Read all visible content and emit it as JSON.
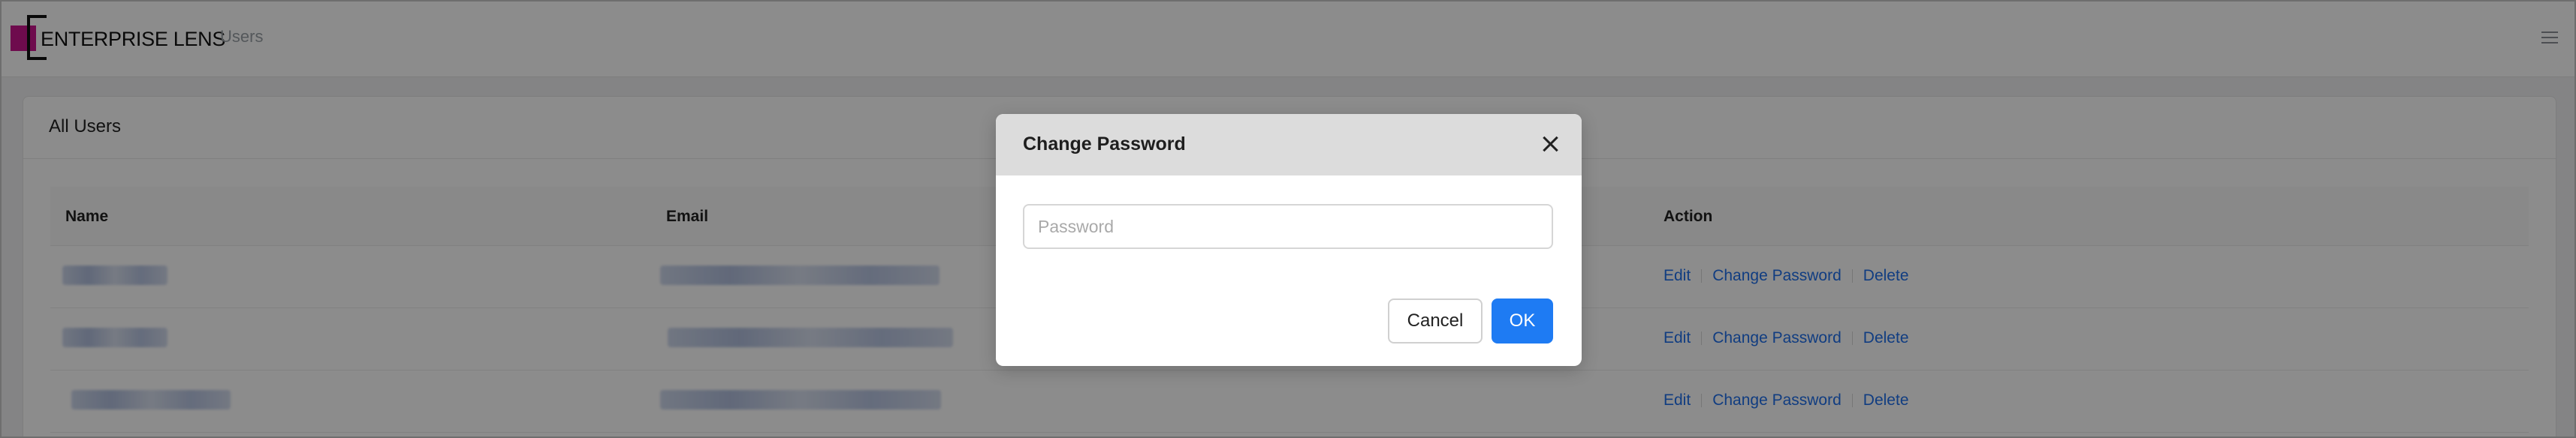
{
  "header": {
    "brand": "ENTERPRISE LENS",
    "page": "Users",
    "menu_icon": "hamburger-icon"
  },
  "card": {
    "title": "All Users"
  },
  "table": {
    "columns": [
      "Name",
      "Email",
      "Action"
    ],
    "rows": [
      {
        "actions": [
          "Edit",
          "Change Password",
          "Delete"
        ]
      },
      {
        "actions": [
          "Edit",
          "Change Password",
          "Delete"
        ]
      },
      {
        "actions": [
          "Edit",
          "Change Password",
          "Delete"
        ]
      }
    ]
  },
  "modal": {
    "title": "Change Password",
    "close_icon": "close-icon",
    "password_placeholder": "Password",
    "password_value": "",
    "cancel_label": "Cancel",
    "ok_label": "OK"
  },
  "colors": {
    "brand": "#c8158d",
    "primary": "#1e7bf3",
    "link": "#1f6feb",
    "overlay": "rgba(0,0,0,0.45)"
  }
}
